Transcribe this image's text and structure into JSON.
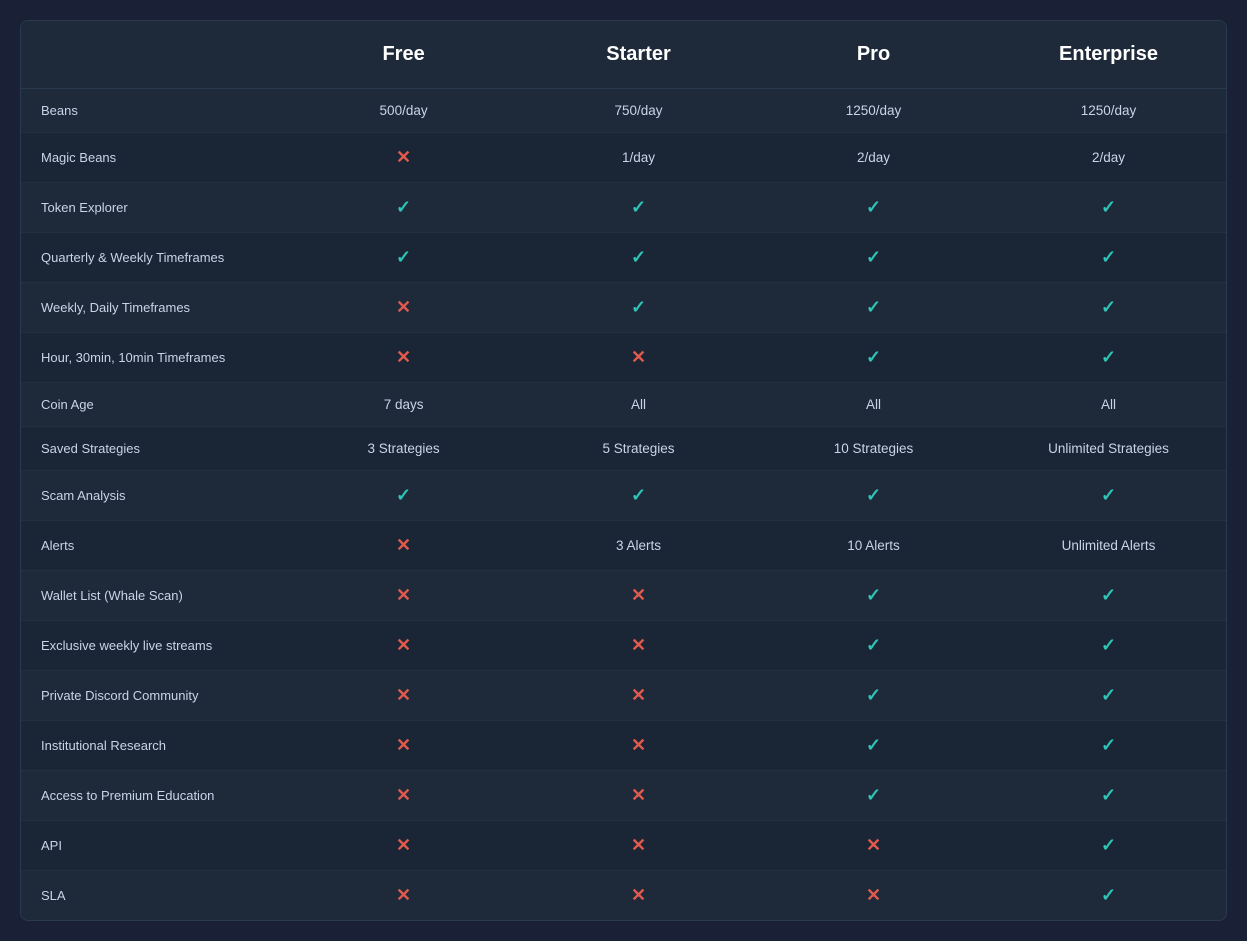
{
  "plans": {
    "headers": [
      "",
      "Free",
      "Starter",
      "Pro",
      "Enterprise"
    ]
  },
  "rows": [
    {
      "feature": "Beans",
      "free": {
        "type": "text",
        "value": "500/day"
      },
      "starter": {
        "type": "text",
        "value": "750/day"
      },
      "pro": {
        "type": "text",
        "value": "1250/day"
      },
      "enterprise": {
        "type": "text",
        "value": "1250/day"
      }
    },
    {
      "feature": "Magic Beans",
      "free": {
        "type": "cross"
      },
      "starter": {
        "type": "text",
        "value": "1/day"
      },
      "pro": {
        "type": "text",
        "value": "2/day"
      },
      "enterprise": {
        "type": "text",
        "value": "2/day"
      }
    },
    {
      "feature": "Token Explorer",
      "free": {
        "type": "check"
      },
      "starter": {
        "type": "check"
      },
      "pro": {
        "type": "check"
      },
      "enterprise": {
        "type": "check"
      }
    },
    {
      "feature": "Quarterly & Weekly Timeframes",
      "free": {
        "type": "check"
      },
      "starter": {
        "type": "check"
      },
      "pro": {
        "type": "check"
      },
      "enterprise": {
        "type": "check"
      }
    },
    {
      "feature": "Weekly, Daily Timeframes",
      "free": {
        "type": "cross"
      },
      "starter": {
        "type": "check"
      },
      "pro": {
        "type": "check"
      },
      "enterprise": {
        "type": "check"
      }
    },
    {
      "feature": "Hour, 30min, 10min Timeframes",
      "free": {
        "type": "cross"
      },
      "starter": {
        "type": "cross"
      },
      "pro": {
        "type": "check"
      },
      "enterprise": {
        "type": "check"
      }
    },
    {
      "feature": "Coin Age",
      "free": {
        "type": "text",
        "value": "7 days"
      },
      "starter": {
        "type": "text",
        "value": "All"
      },
      "pro": {
        "type": "text",
        "value": "All"
      },
      "enterprise": {
        "type": "text",
        "value": "All"
      }
    },
    {
      "feature": "Saved Strategies",
      "free": {
        "type": "text",
        "value": "3 Strategies"
      },
      "starter": {
        "type": "text",
        "value": "5 Strategies"
      },
      "pro": {
        "type": "text",
        "value": "10 Strategies"
      },
      "enterprise": {
        "type": "text",
        "value": "Unlimited Strategies"
      }
    },
    {
      "feature": "Scam Analysis",
      "free": {
        "type": "check"
      },
      "starter": {
        "type": "check"
      },
      "pro": {
        "type": "check"
      },
      "enterprise": {
        "type": "check"
      }
    },
    {
      "feature": "Alerts",
      "free": {
        "type": "cross"
      },
      "starter": {
        "type": "text",
        "value": "3 Alerts"
      },
      "pro": {
        "type": "text",
        "value": "10 Alerts"
      },
      "enterprise": {
        "type": "text",
        "value": "Unlimited Alerts"
      }
    },
    {
      "feature": "Wallet List (Whale Scan)",
      "free": {
        "type": "cross"
      },
      "starter": {
        "type": "cross"
      },
      "pro": {
        "type": "check"
      },
      "enterprise": {
        "type": "check"
      }
    },
    {
      "feature": "Exclusive weekly live streams",
      "free": {
        "type": "cross"
      },
      "starter": {
        "type": "cross"
      },
      "pro": {
        "type": "check"
      },
      "enterprise": {
        "type": "check"
      }
    },
    {
      "feature": "Private Discord Community",
      "free": {
        "type": "cross"
      },
      "starter": {
        "type": "cross"
      },
      "pro": {
        "type": "check"
      },
      "enterprise": {
        "type": "check"
      }
    },
    {
      "feature": "Institutional Research",
      "free": {
        "type": "cross"
      },
      "starter": {
        "type": "cross"
      },
      "pro": {
        "type": "check"
      },
      "enterprise": {
        "type": "check"
      }
    },
    {
      "feature": "Access to Premium Education",
      "free": {
        "type": "cross"
      },
      "starter": {
        "type": "cross"
      },
      "pro": {
        "type": "check"
      },
      "enterprise": {
        "type": "check"
      }
    },
    {
      "feature": "API",
      "free": {
        "type": "cross"
      },
      "starter": {
        "type": "cross"
      },
      "pro": {
        "type": "cross"
      },
      "enterprise": {
        "type": "check"
      }
    },
    {
      "feature": "SLA",
      "free": {
        "type": "cross"
      },
      "starter": {
        "type": "cross"
      },
      "pro": {
        "type": "cross"
      },
      "enterprise": {
        "type": "check"
      }
    }
  ],
  "symbols": {
    "check": "✓",
    "cross": "✕"
  }
}
